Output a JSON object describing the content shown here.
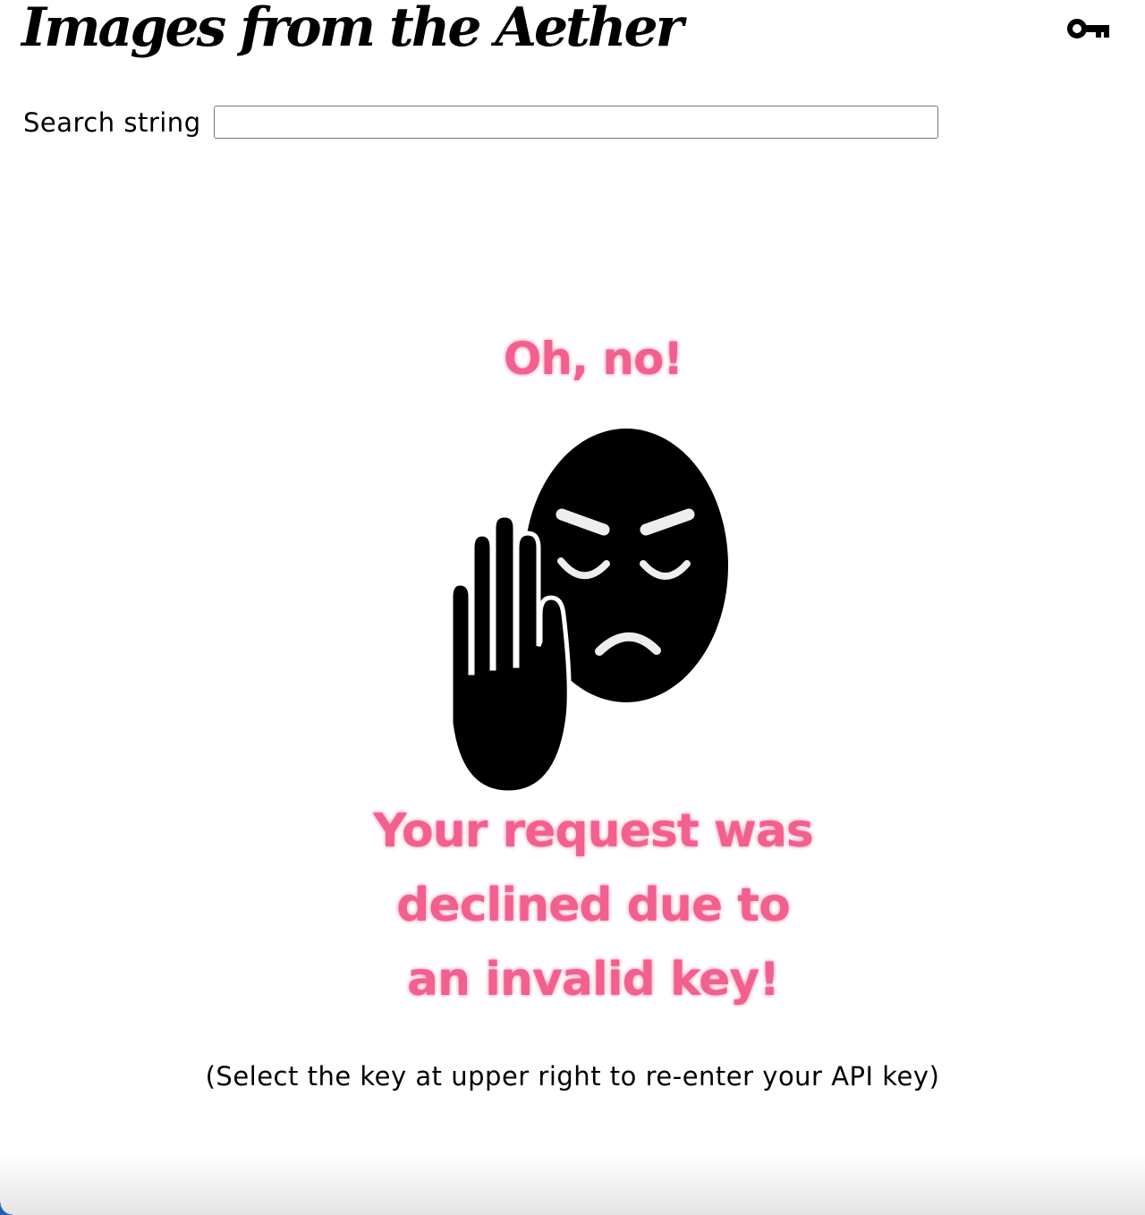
{
  "header": {
    "title": "Images from the Aether",
    "key_icon": "key-icon"
  },
  "search": {
    "label": "Search string",
    "value": "",
    "placeholder": ""
  },
  "error": {
    "heading": "Oh, no!",
    "illustration_icon": "stop-hand-angry-face-icon",
    "message": "Your request was declined due to an invalid key!",
    "hint": "(Select the key at upper right to re-enter your API key)"
  },
  "colors": {
    "error_text": "#f2608d",
    "icon": "#000000",
    "background": "#ffffff"
  }
}
